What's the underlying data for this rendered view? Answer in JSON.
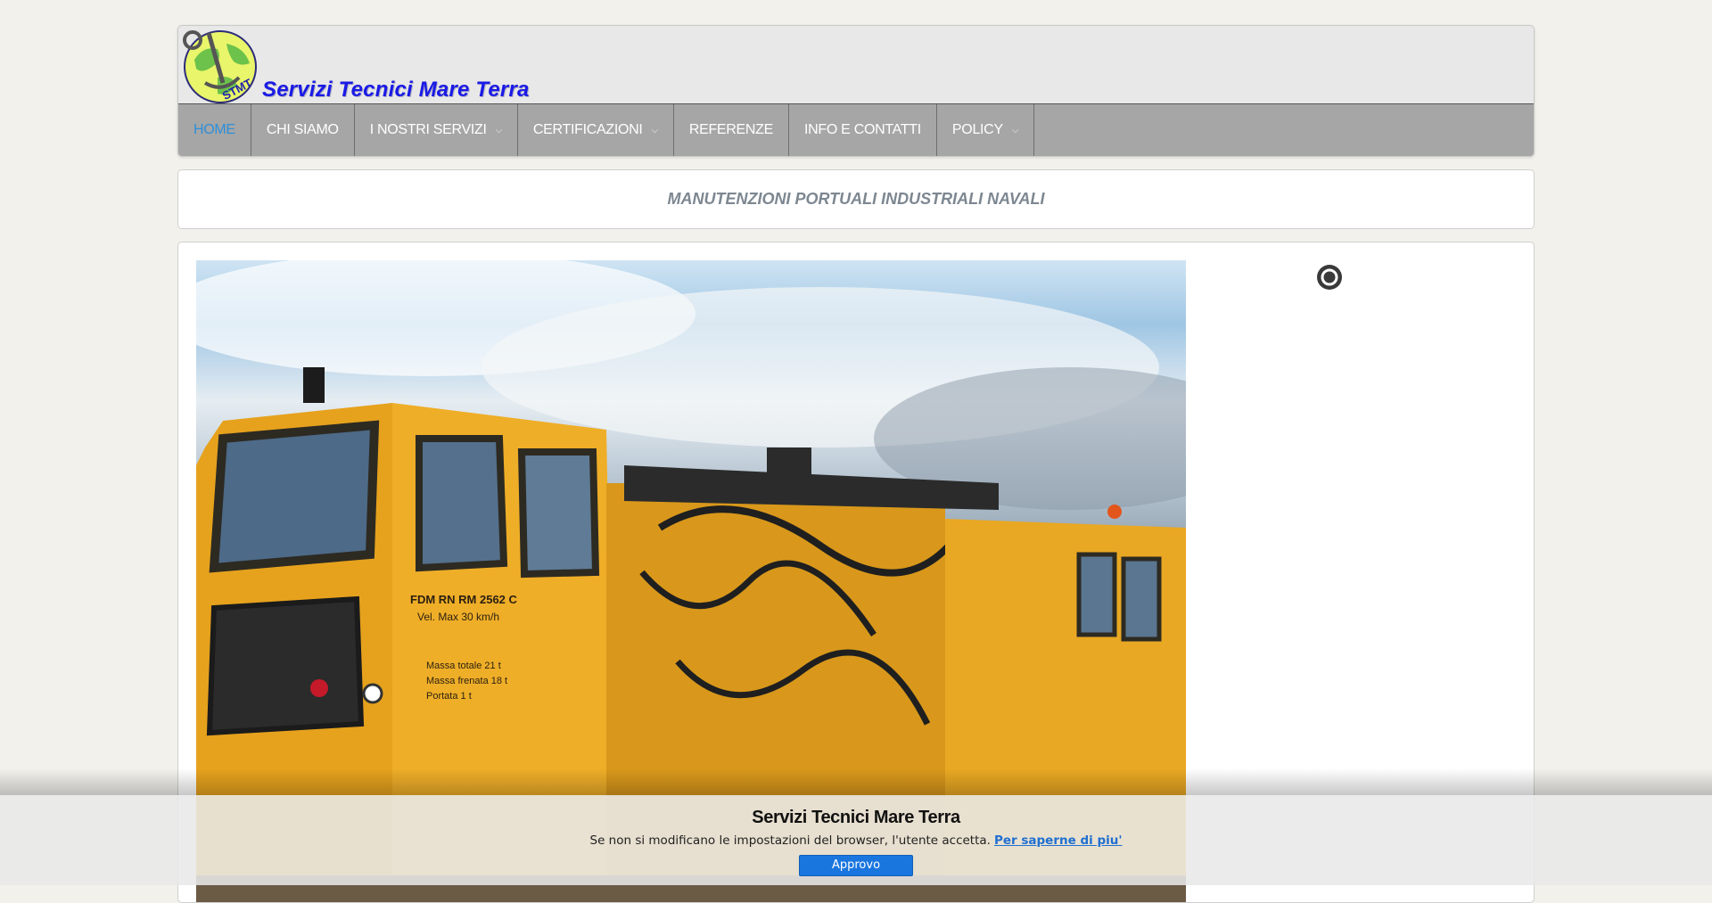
{
  "header": {
    "brand_title": "Servizi Tecnici Mare Terra",
    "logo_text": "STMT",
    "colors": {
      "brand": "#1a1ae6",
      "nav_bg": "#a6a6a6",
      "active": "#2f8fd8"
    }
  },
  "nav": {
    "items": [
      {
        "label": "HOME",
        "active": true,
        "has_dropdown": false
      },
      {
        "label": "CHI SIAMO",
        "active": false,
        "has_dropdown": false
      },
      {
        "label": "I NOSTRI SERVIZI",
        "active": false,
        "has_dropdown": true
      },
      {
        "label": "CERTIFICAZIONI",
        "active": false,
        "has_dropdown": true
      },
      {
        "label": "REFERENZE",
        "active": false,
        "has_dropdown": false
      },
      {
        "label": "INFO E CONTATTI",
        "active": false,
        "has_dropdown": false
      },
      {
        "label": "POLICY",
        "active": false,
        "has_dropdown": true
      }
    ],
    "caret_icon": "chevron-down-icon"
  },
  "tagline": "MANUTENZIONI PORTUALI INDUSTRIALI NAVALI",
  "slider": {
    "loading_icon": "spinner-icon",
    "sign_lines": [
      "FDM RN RM 2562 C",
      "Vel. Max 30 km/h",
      "Massa totale 21 t",
      "Massa frenata 18 t",
      "Portata 1 t"
    ]
  },
  "cookie": {
    "title": "Servizi Tecnici Mare Terra",
    "text": "Se non si modificano le impostazioni del browser, l'utente accetta.",
    "link": "Per saperne di piu'",
    "button": "Approvo"
  }
}
